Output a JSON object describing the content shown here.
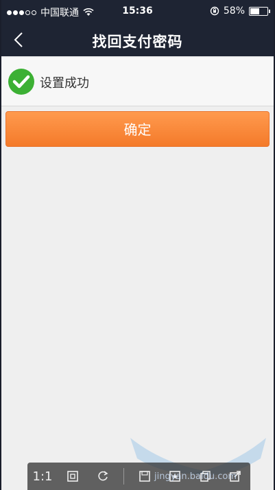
{
  "status_bar": {
    "carrier": "中国联通",
    "time": "15:36",
    "battery": "58%",
    "battery_level": 0.58
  },
  "nav": {
    "title": "找回支付密码",
    "back_icon": "chevron-left-icon"
  },
  "result": {
    "icon": "check-circle-icon",
    "text": "设置成功",
    "accent": "#3cb034"
  },
  "confirm_button": {
    "label": "确定",
    "color": "#f58a3a"
  },
  "photo_toolbar": {
    "items": [
      "1:1",
      "fit-screen-icon",
      "rotate-icon",
      "save-icon",
      "star-icon",
      "copy-icon",
      "share-icon"
    ]
  },
  "watermark": {
    "text": "jingyan.baidu.com"
  }
}
